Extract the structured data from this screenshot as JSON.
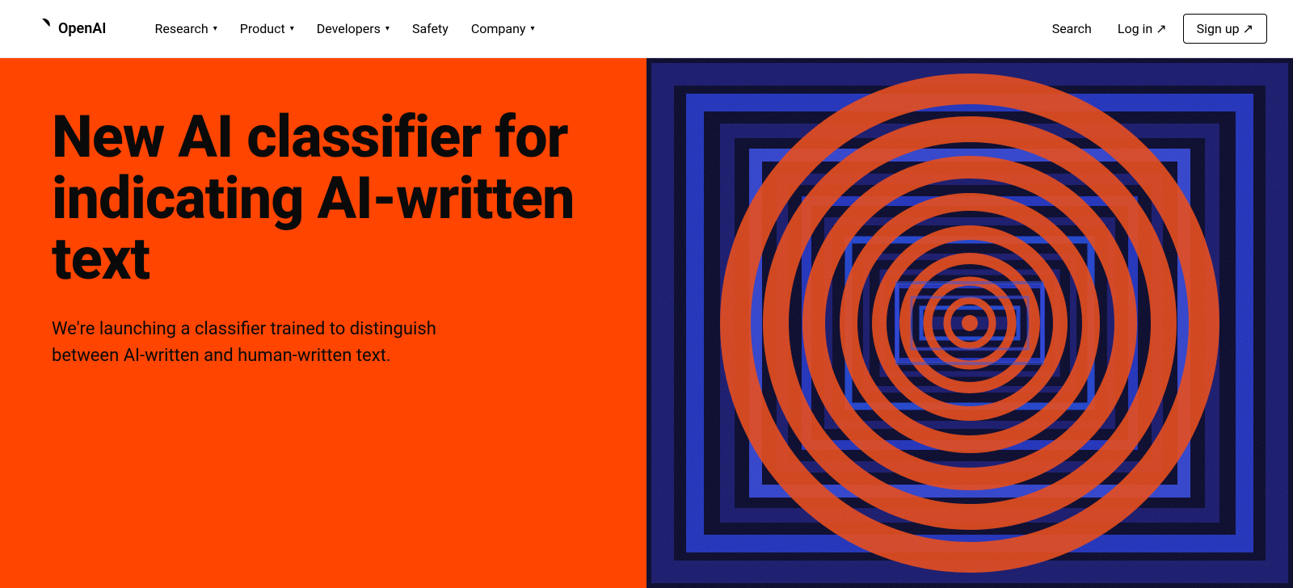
{
  "brand": {
    "name": "OpenAI",
    "logo_alt": "OpenAI logo"
  },
  "nav": {
    "links": [
      {
        "label": "Research",
        "has_dropdown": true
      },
      {
        "label": "Product",
        "has_dropdown": true
      },
      {
        "label": "Developers",
        "has_dropdown": true
      },
      {
        "label": "Safety",
        "has_dropdown": false
      },
      {
        "label": "Company",
        "has_dropdown": true
      }
    ],
    "search_label": "Search",
    "login_label": "Log in ↗",
    "signup_label": "Sign up ↗"
  },
  "hero": {
    "title": "New AI classifier for indicating AI-written text",
    "subtitle": "We're launching a classifier trained to distinguish between AI-written and human-written text.",
    "bg_color": "#ff4500",
    "art_bg": "#0a0a2e"
  }
}
